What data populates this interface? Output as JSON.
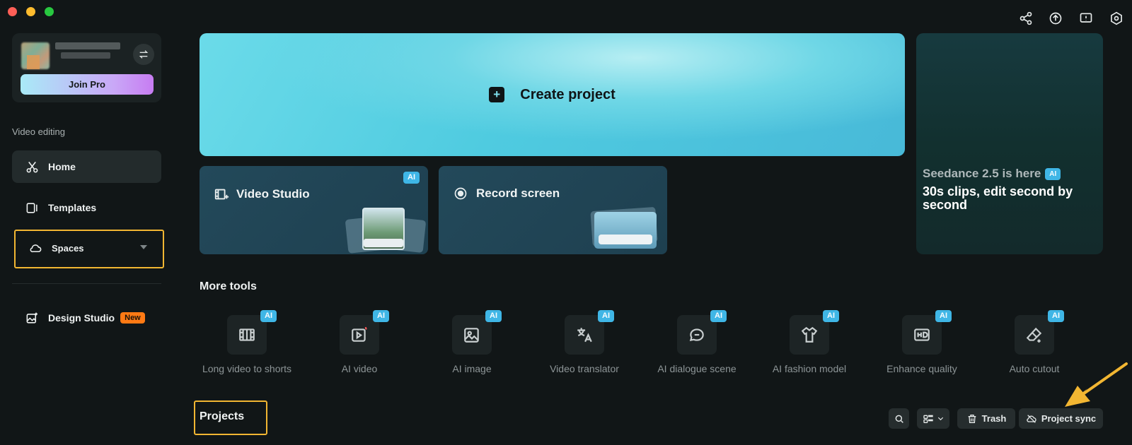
{
  "window": {
    "controls": [
      "close",
      "minimize",
      "maximize"
    ]
  },
  "topbar": {
    "icons": [
      "share-icon",
      "upload-icon",
      "feedback-icon",
      "settings-icon"
    ]
  },
  "sidebar": {
    "join_pro_label": "Join Pro",
    "section_label": "Video editing",
    "items": [
      {
        "label": "Home",
        "icon": "scissors-icon",
        "active": true
      },
      {
        "label": "Templates",
        "icon": "templates-icon",
        "active": false
      },
      {
        "label": "Spaces",
        "icon": "cloud-icon",
        "active": false
      },
      {
        "label": "Design Studio",
        "icon": "design-image-icon",
        "badge": "New",
        "active": false
      }
    ]
  },
  "main": {
    "create_project_label": "Create project",
    "video_studio": {
      "label": "Video Studio",
      "badge": "AI"
    },
    "record_screen": {
      "label": "Record screen"
    },
    "promo": {
      "headline": "Seedance 2.5 is here",
      "badge": "AI",
      "subtitle": "30s clips, edit second by second"
    },
    "more_tools_title": "More tools",
    "tools": [
      {
        "label": "Long video to shorts",
        "badge": "AI",
        "icon": "film-split-icon"
      },
      {
        "label": "AI video",
        "badge": "AI",
        "icon": "video-play-icon"
      },
      {
        "label": "AI image",
        "badge": "AI",
        "icon": "image-icon"
      },
      {
        "label": "Video translator",
        "badge": "AI",
        "icon": "translate-icon"
      },
      {
        "label": "AI dialogue scene",
        "badge": "AI",
        "icon": "dialogue-icon"
      },
      {
        "label": "AI fashion model",
        "badge": "AI",
        "icon": "shirt-icon"
      },
      {
        "label": "Enhance quality",
        "badge": "AI",
        "icon": "hd-icon"
      },
      {
        "label": "Auto cutout",
        "badge": "AI",
        "icon": "eraser-icon"
      }
    ],
    "projects_title": "Projects",
    "toolbar": {
      "trash_label": "Trash",
      "sync_label": "Project sync"
    }
  },
  "colors": {
    "background": "#111617",
    "accent_cyan": "#4fcbe0",
    "highlight_yellow": "#f2b632",
    "ai_badge": "#3fb6e6",
    "new_badge": "#ff7a14"
  }
}
